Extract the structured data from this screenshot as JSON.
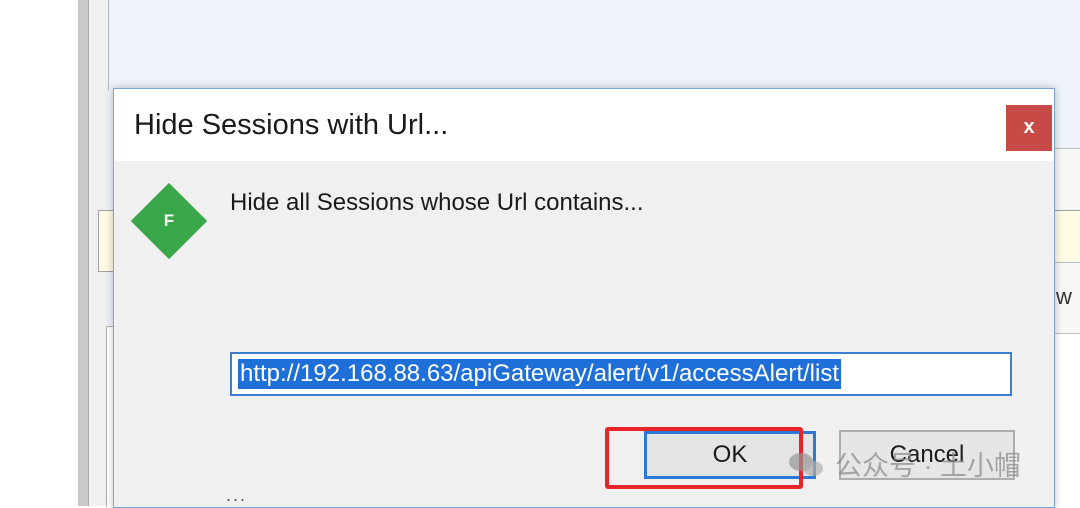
{
  "background": {
    "right_partial_text": "w",
    "partial_bottom_text": "..."
  },
  "dialog": {
    "title": "Hide Sessions with Url...",
    "close_label": "x",
    "icon_letter": "F",
    "message": "Hide all Sessions whose Url contains...",
    "url_value": "http://192.168.88.63/apiGateway/alert/v1/accessAlert/list",
    "ok_label": "OK",
    "cancel_label": "Cancel"
  },
  "watermark": {
    "text": "公众号 · 土小帽"
  },
  "colors": {
    "close_button": "#c84a46",
    "app_icon": "#3aa64a",
    "selection": "#1f6fd8",
    "highlight_box": "#e8242a",
    "ok_border": "#2a7bd6"
  }
}
